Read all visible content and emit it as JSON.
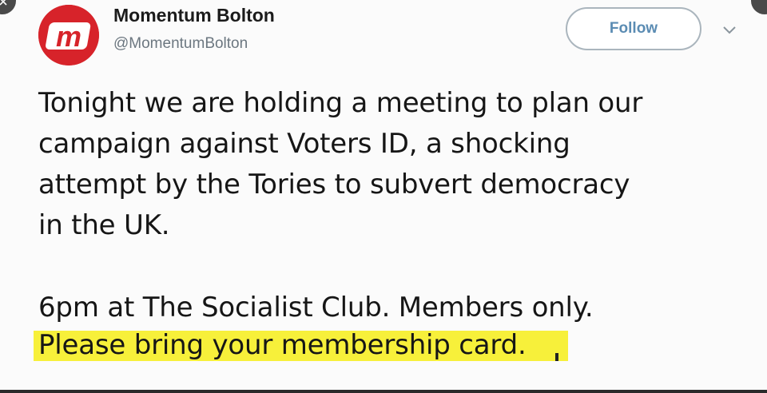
{
  "tweet": {
    "display_name": "Momentum Bolton",
    "handle": "@MomentumBolton",
    "follow_label": "Follow",
    "avatar_text": "m",
    "text_lines": [
      "Tonight we are holding a meeting to plan our",
      "campaign against Voters ID, a shocking",
      "attempt by the Tories to subvert democracy",
      "in the UK."
    ],
    "text_lines_2": [
      "6pm at The Socialist Club. Members only."
    ],
    "highlighted_line": "Please bring your membership card."
  },
  "icons": {
    "avatar_logo": "momentum-logo-icon",
    "caret": "chevron-down-icon",
    "close": "close-icon"
  },
  "colors": {
    "avatar_bg": "#d7232a",
    "follow_text": "#5b8cb3",
    "highlight": "#f7f03a"
  }
}
